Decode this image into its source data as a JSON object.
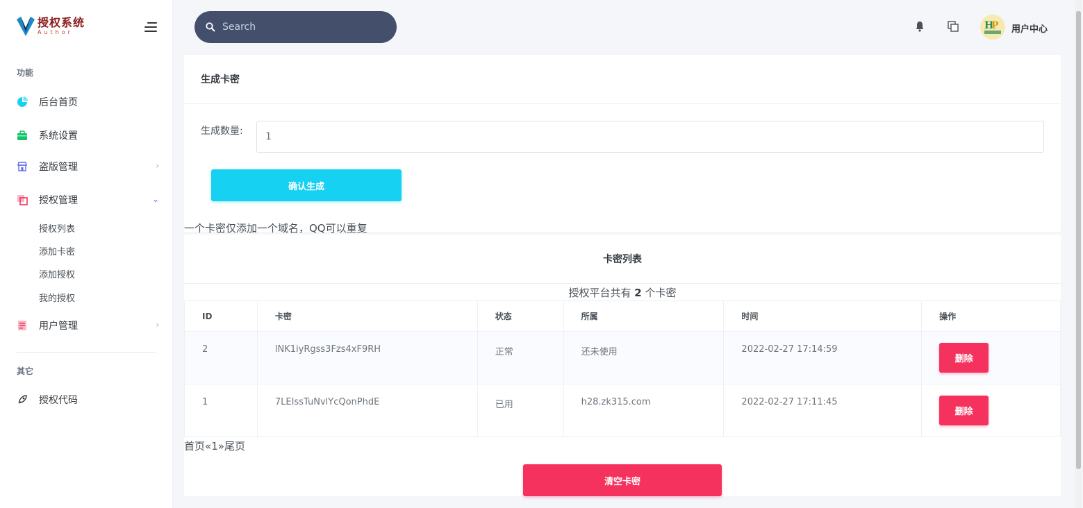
{
  "brand": {
    "title": "授权系统",
    "subtitle": "Author"
  },
  "sidebar": {
    "section_main": "功能",
    "items": [
      {
        "label": "后台首页",
        "icon": "pie-chart-icon",
        "color": "#16d1f2"
      },
      {
        "label": "系统设置",
        "icon": "briefcase-icon",
        "color": "#10c469"
      },
      {
        "label": "盗版管理",
        "icon": "store-icon",
        "color": "#5b6be8"
      },
      {
        "label": "授权管理",
        "icon": "copy-icon",
        "color": "#f4325d"
      }
    ],
    "sub_items": [
      "授权列表",
      "添加卡密",
      "添加授权",
      "我的授权"
    ],
    "user_mgmt": {
      "label": "用户管理",
      "icon": "document-icon",
      "color": "#f4325d"
    },
    "section_other": "其它",
    "code": {
      "label": "授权代码",
      "icon": "rocket-icon"
    }
  },
  "topbar": {
    "search_placeholder": "Search",
    "user_label": "用户中心"
  },
  "generate": {
    "title": "生成卡密",
    "qty_label": "生成数量:",
    "qty_value": "1",
    "confirm_label": "确认生成"
  },
  "note": "一个卡密仅添加一个域名，QQ可以重复",
  "list": {
    "title": "卡密列表",
    "count_prefix": "授权平台共有 ",
    "count": "2",
    "count_suffix": " 个卡密",
    "columns": [
      "ID",
      "卡密",
      "状态",
      "所属",
      "时间",
      "操作"
    ],
    "rows": [
      {
        "id": "2",
        "key": "lNK1iyRgss3Fzs4xF9RH",
        "status": "正常",
        "owner": "还未使用",
        "time": "2022-02-27 17:14:59",
        "action": "删除"
      },
      {
        "id": "1",
        "key": "7LEIssTuNvlYcQonPhdE",
        "status": "已用",
        "owner": "h28.zk315.com",
        "time": "2022-02-27 17:11:45",
        "action": "删除"
      }
    ],
    "pager": {
      "first": "首页",
      "prev": "«",
      "page": "1",
      "next": "»",
      "last": "尾页"
    },
    "clear_label": "清空卡密"
  },
  "colors": {
    "accent_cyan": "#16d1f2",
    "danger": "#f4325d",
    "search_bg": "#444f6c"
  }
}
